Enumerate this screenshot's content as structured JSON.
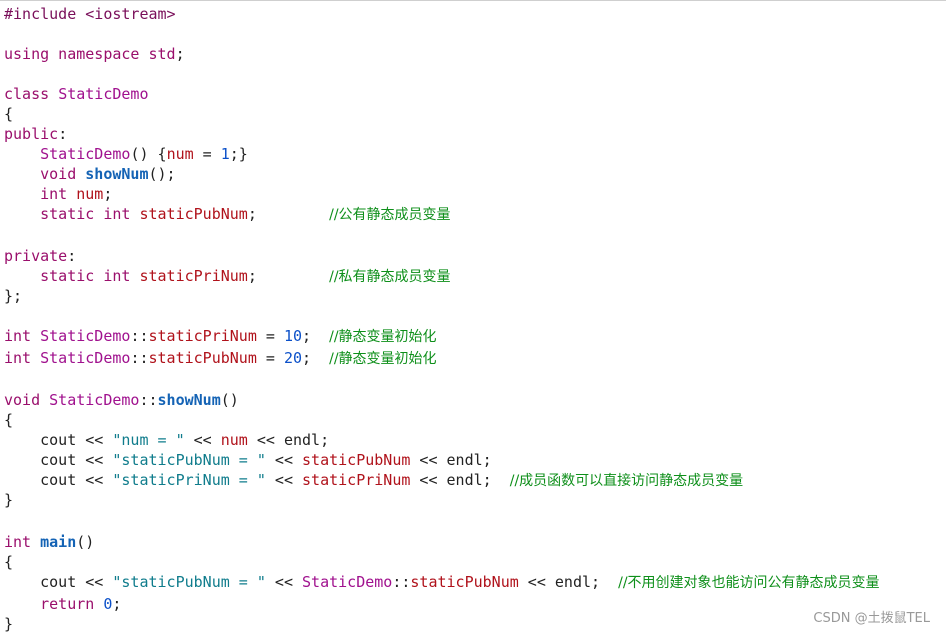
{
  "editor": {
    "language": "cpp",
    "colors": {
      "default": "#222222",
      "preprocessor": "#7a0f5a",
      "keyword": "#9a0f6c",
      "class_name": "#a0118e",
      "function_bold": "#1463b5",
      "variable": "#b0121b",
      "string": "#0f7c8c",
      "number": "#0b50c9",
      "comment": "#0e8f1a"
    },
    "lines": [
      {
        "y": 2,
        "tokens": [
          {
            "t": "#include <iostream>",
            "c": "preprocessor"
          }
        ]
      },
      {
        "y": 2,
        "tokens": []
      },
      {
        "y": 2,
        "tokens": [
          {
            "t": "using namespace std",
            "c": "keyword"
          },
          {
            "t": ";",
            "c": "default"
          }
        ]
      },
      {
        "y": 2,
        "tokens": []
      },
      {
        "y": 2,
        "tokens": [
          {
            "t": "class ",
            "c": "keyword"
          },
          {
            "t": "StaticDemo",
            "c": "class_name"
          }
        ]
      },
      {
        "y": 2,
        "tokens": [
          {
            "t": "{",
            "c": "default"
          }
        ]
      },
      {
        "y": 2,
        "tokens": [
          {
            "t": "public",
            "c": "keyword"
          },
          {
            "t": ":",
            "c": "default"
          }
        ]
      },
      {
        "y": 2,
        "tokens": [
          {
            "t": "    ",
            "c": "default"
          },
          {
            "t": "StaticDemo",
            "c": "class_name"
          },
          {
            "t": "() {",
            "c": "default"
          },
          {
            "t": "num",
            "c": "variable"
          },
          {
            "t": " = ",
            "c": "default"
          },
          {
            "t": "1",
            "c": "number"
          },
          {
            "t": ";}",
            "c": "default"
          }
        ]
      },
      {
        "y": 2,
        "tokens": [
          {
            "t": "    void ",
            "c": "keyword"
          },
          {
            "t": "showNum",
            "c": "function_bold",
            "bold": true
          },
          {
            "t": "();",
            "c": "default"
          }
        ]
      },
      {
        "y": 2,
        "tokens": [
          {
            "t": "    int ",
            "c": "keyword"
          },
          {
            "t": "num",
            "c": "variable"
          },
          {
            "t": ";",
            "c": "default"
          }
        ]
      },
      {
        "y": 2,
        "tokens": [
          {
            "t": "    static int ",
            "c": "keyword"
          },
          {
            "t": "staticPubNum",
            "c": "variable"
          },
          {
            "t": ";        ",
            "c": "default"
          },
          {
            "t": "//公有静态成员变量",
            "c": "comment",
            "cm": true
          }
        ]
      },
      {
        "y": 2,
        "tokens": []
      },
      {
        "y": 2,
        "tokens": [
          {
            "t": "private",
            "c": "keyword"
          },
          {
            "t": ":",
            "c": "default"
          }
        ]
      },
      {
        "y": 2,
        "tokens": [
          {
            "t": "    static int ",
            "c": "keyword"
          },
          {
            "t": "staticPriNum",
            "c": "variable"
          },
          {
            "t": ";        ",
            "c": "default"
          },
          {
            "t": "//私有静态成员变量",
            "c": "comment",
            "cm": true
          }
        ]
      },
      {
        "y": 2,
        "tokens": [
          {
            "t": "};",
            "c": "default"
          }
        ]
      },
      {
        "y": 2,
        "tokens": []
      },
      {
        "y": 2,
        "tokens": [
          {
            "t": "int ",
            "c": "keyword"
          },
          {
            "t": "StaticDemo",
            "c": "class_name"
          },
          {
            "t": "::",
            "c": "default"
          },
          {
            "t": "staticPriNum",
            "c": "variable"
          },
          {
            "t": " = ",
            "c": "default"
          },
          {
            "t": "10",
            "c": "number"
          },
          {
            "t": ";  ",
            "c": "default"
          },
          {
            "t": "//静态变量初始化",
            "c": "comment",
            "cm": true
          }
        ]
      },
      {
        "y": 2,
        "tokens": [
          {
            "t": "int ",
            "c": "keyword"
          },
          {
            "t": "StaticDemo",
            "c": "class_name"
          },
          {
            "t": "::",
            "c": "default"
          },
          {
            "t": "staticPubNum",
            "c": "variable"
          },
          {
            "t": " = ",
            "c": "default"
          },
          {
            "t": "20",
            "c": "number"
          },
          {
            "t": ";  ",
            "c": "default"
          },
          {
            "t": "//静态变量初始化",
            "c": "comment",
            "cm": true
          }
        ]
      },
      {
        "y": 2,
        "tokens": []
      },
      {
        "y": 2,
        "tokens": [
          {
            "t": "void ",
            "c": "keyword"
          },
          {
            "t": "StaticDemo",
            "c": "class_name"
          },
          {
            "t": "::",
            "c": "default"
          },
          {
            "t": "showNum",
            "c": "function_bold",
            "bold": true
          },
          {
            "t": "()",
            "c": "default"
          }
        ]
      },
      {
        "y": 2,
        "tokens": [
          {
            "t": "{",
            "c": "default"
          }
        ]
      },
      {
        "y": 2,
        "tokens": [
          {
            "t": "    cout << ",
            "c": "default"
          },
          {
            "t": "\"num = \"",
            "c": "string"
          },
          {
            "t": " << ",
            "c": "default"
          },
          {
            "t": "num",
            "c": "variable"
          },
          {
            "t": " << endl;",
            "c": "default"
          }
        ]
      },
      {
        "y": 2,
        "tokens": [
          {
            "t": "    cout << ",
            "c": "default"
          },
          {
            "t": "\"staticPubNum = \"",
            "c": "string"
          },
          {
            "t": " << ",
            "c": "default"
          },
          {
            "t": "staticPubNum",
            "c": "variable"
          },
          {
            "t": " << endl;",
            "c": "default"
          }
        ]
      },
      {
        "y": 2,
        "tokens": [
          {
            "t": "    cout << ",
            "c": "default"
          },
          {
            "t": "\"staticPriNum = \"",
            "c": "string"
          },
          {
            "t": " << ",
            "c": "default"
          },
          {
            "t": "staticPriNum",
            "c": "variable"
          },
          {
            "t": " << endl;  ",
            "c": "default"
          },
          {
            "t": "//成员函数可以直接访问静态成员变量",
            "c": "comment",
            "cm": true
          }
        ]
      },
      {
        "y": 2,
        "tokens": [
          {
            "t": "}",
            "c": "default"
          }
        ]
      },
      {
        "y": 2,
        "tokens": []
      },
      {
        "y": 2,
        "tokens": [
          {
            "t": "int ",
            "c": "keyword"
          },
          {
            "t": "main",
            "c": "function_bold",
            "bold": true
          },
          {
            "t": "()",
            "c": "default"
          }
        ]
      },
      {
        "y": 2,
        "tokens": [
          {
            "t": "{",
            "c": "default"
          }
        ]
      },
      {
        "y": 2,
        "tokens": [
          {
            "t": "    cout << ",
            "c": "default"
          },
          {
            "t": "\"staticPubNum = \"",
            "c": "string"
          },
          {
            "t": " << ",
            "c": "default"
          },
          {
            "t": "StaticDemo",
            "c": "class_name"
          },
          {
            "t": "::",
            "c": "default"
          },
          {
            "t": "staticPubNum",
            "c": "variable"
          },
          {
            "t": " << endl;  ",
            "c": "default"
          },
          {
            "t": "//不用创建对象也能访问公有静态成员变量",
            "c": "comment",
            "cm": true
          }
        ]
      },
      {
        "y": 2,
        "tokens": [
          {
            "t": "    return ",
            "c": "keyword"
          },
          {
            "t": "0",
            "c": "number"
          },
          {
            "t": ";",
            "c": "default"
          }
        ]
      },
      {
        "y": 2,
        "tokens": [
          {
            "t": "}",
            "c": "default"
          }
        ]
      }
    ]
  },
  "watermark": {
    "text": "CSDN @土拨鼠TEL"
  }
}
